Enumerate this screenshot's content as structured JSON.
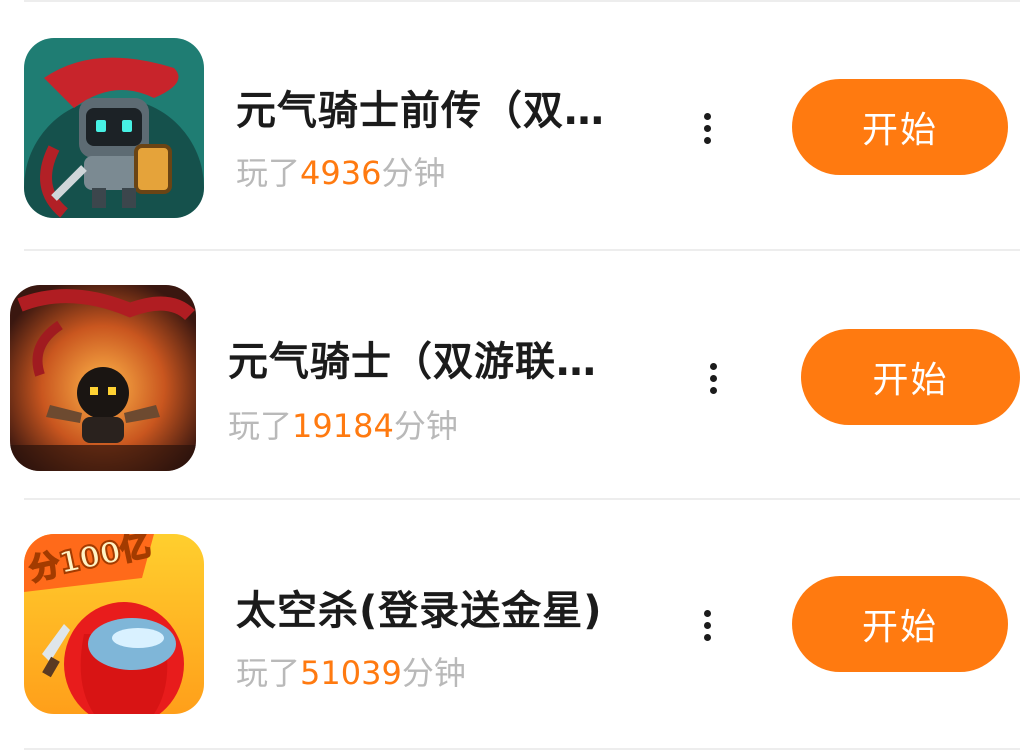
{
  "games": [
    {
      "title": "元气骑士前传（双…",
      "playtime_prefix": "玩了",
      "playtime_minutes": "4936",
      "playtime_suffix": "分钟",
      "start_label": "开始",
      "icon": "soul-knight-prequel-icon"
    },
    {
      "title": "元气骑士（双游联…",
      "playtime_prefix": "玩了",
      "playtime_minutes": "19184",
      "playtime_suffix": "分钟",
      "start_label": "开始",
      "icon": "soul-knight-icon"
    },
    {
      "title": "太空杀(登录送金星)",
      "playtime_prefix": "玩了",
      "playtime_minutes": "51039",
      "playtime_suffix": "分钟",
      "start_label": "开始",
      "icon": "space-werewolf-icon",
      "icon_badge": "分100亿"
    }
  ],
  "colors": {
    "accent": "#ff7a10",
    "title": "#1b1b1b",
    "muted": "#b9b9b9",
    "divider": "#ededed"
  }
}
